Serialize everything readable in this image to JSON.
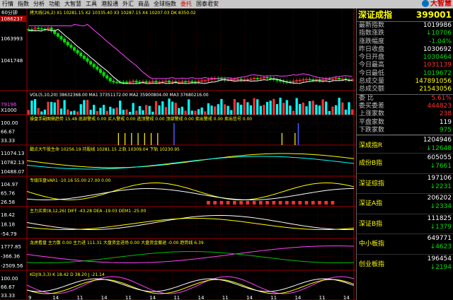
{
  "menu": {
    "items": [
      "行情",
      "指数",
      "分析",
      "功能",
      "大智慧",
      "工具",
      "港股通",
      "外汇",
      "商品",
      "全球指数",
      "委托",
      "国泰君安"
    ],
    "active": "委托"
  },
  "logo": {
    "text": "大智慧"
  },
  "chart": {
    "period": "60分钟",
    "main_legend": "拷大线(26,2) X1 10281.15 X2 10335.40 X3 10287.15 X4 10207.03 DK 8350.02",
    "y_labels": [
      "1086237",
      "1063993",
      "1041748"
    ],
    "vol_legend": "VOL(5,10,20)   38632368.00  MA1 37351172.00  MA2 35900804.00  MA3 37680216.00",
    "vol_y": [
      "79196",
      "X1000"
    ],
    "p1_legend": "操盘手副图鼎趋势 15.48  底部警戒 0.00  买入警戒 0.00  逃顶警戒 0.00  顶部警戒 0.00  卖出警戒 0.00  卖出信号 0.00",
    "p1_y": [
      "100.00",
      "66.67",
      "33.33"
    ],
    "p2_legend": "戳点大牛股生命  10256.19  持股线 10281.15  上轨 10309.04  下轨 10230.95",
    "p2_y": [
      "11074.13",
      "10782.13",
      "10488.07"
    ],
    "p3_legend": "专级压盘VAR1 -10.16   55.00  27.00  0.00",
    "p3_y": [
      "104.97",
      "65.76",
      "26.58"
    ],
    "p4_legend": "主力买卖(8,12,26)  DIFF -43.28  DEA -19.03  DEM1 -25.00",
    "p4_y": [
      "18.42",
      "18.18",
      "-54.79"
    ],
    "p5_legend": "龙虎看盘  主力散  0.00  主力进  111.31  大盘资金进场  0.00  大盘资金撤退  -0.00  趋势线  6.39",
    "p5_y": [
      "1777.85",
      "-366.36",
      "-2509.56"
    ],
    "p6_legend": "KDJ(9,3,3)  K 18.42  D 38.20  J -21.14",
    "p6_y": [
      "100.00",
      "66.67",
      "33.33"
    ],
    "x_labels": [
      "9",
      "14",
      "11",
      "14",
      "11",
      "14",
      "11",
      "14",
      "11",
      "14",
      "11",
      "14",
      "11",
      "14"
    ]
  },
  "side": {
    "title": "深证成指",
    "code": "399001",
    "rows": [
      {
        "label": "最新指数",
        "value": "1019986",
        "color": "white"
      },
      {
        "label": "指数涨跌",
        "value": "↓10706",
        "color": "green"
      },
      {
        "label": "涨跌幅度",
        "value": "-1.04%",
        "color": "green"
      },
      {
        "label": "昨日收盘",
        "value": "1030692",
        "color": "white"
      },
      {
        "label": "今日开盘",
        "value": "1030464",
        "color": "green"
      },
      {
        "label": "今日最高",
        "value": "1031139",
        "color": "red"
      },
      {
        "label": "今日最低",
        "value": "1019672",
        "color": "green"
      },
      {
        "label": "总成交量",
        "value": "147891056",
        "color": "yellow"
      },
      {
        "label": "总成交额",
        "value": "21543056",
        "color": "yellow"
      }
    ],
    "rows2": [
      {
        "label": "委      比",
        "value": "5.61%",
        "color": "red"
      },
      {
        "label": "委买委差",
        "value": "444823",
        "color": "red"
      },
      {
        "label": "上涨家数",
        "value": "238",
        "color": "red"
      },
      {
        "label": "平盘家数",
        "value": "119",
        "color": "white"
      },
      {
        "label": "下跌家数",
        "value": "975",
        "color": "green"
      }
    ],
    "indices": [
      {
        "label": "深成指R",
        "value": "1204946",
        "change": "↓12648"
      },
      {
        "label": "成份B指",
        "value": "605055",
        "change": "↓7661"
      },
      {
        "label": "深证综指",
        "value": "197106",
        "change": "↓2231"
      },
      {
        "label": "深证A指",
        "value": "206202",
        "change": "↓2334"
      },
      {
        "label": "深证B指",
        "value": "111825",
        "change": "↓1379"
      },
      {
        "label": "中小板指",
        "value": "649771",
        "change": "↓4623"
      },
      {
        "label": "创业板指",
        "value": "196454",
        "change": "↓2194"
      }
    ]
  },
  "colors": {
    "up": "#ff3030",
    "down": "#00e000",
    "grid": "#7a0000",
    "yellow": "#ffff00",
    "cyan": "#00ffff",
    "magenta": "#ff40ff"
  }
}
